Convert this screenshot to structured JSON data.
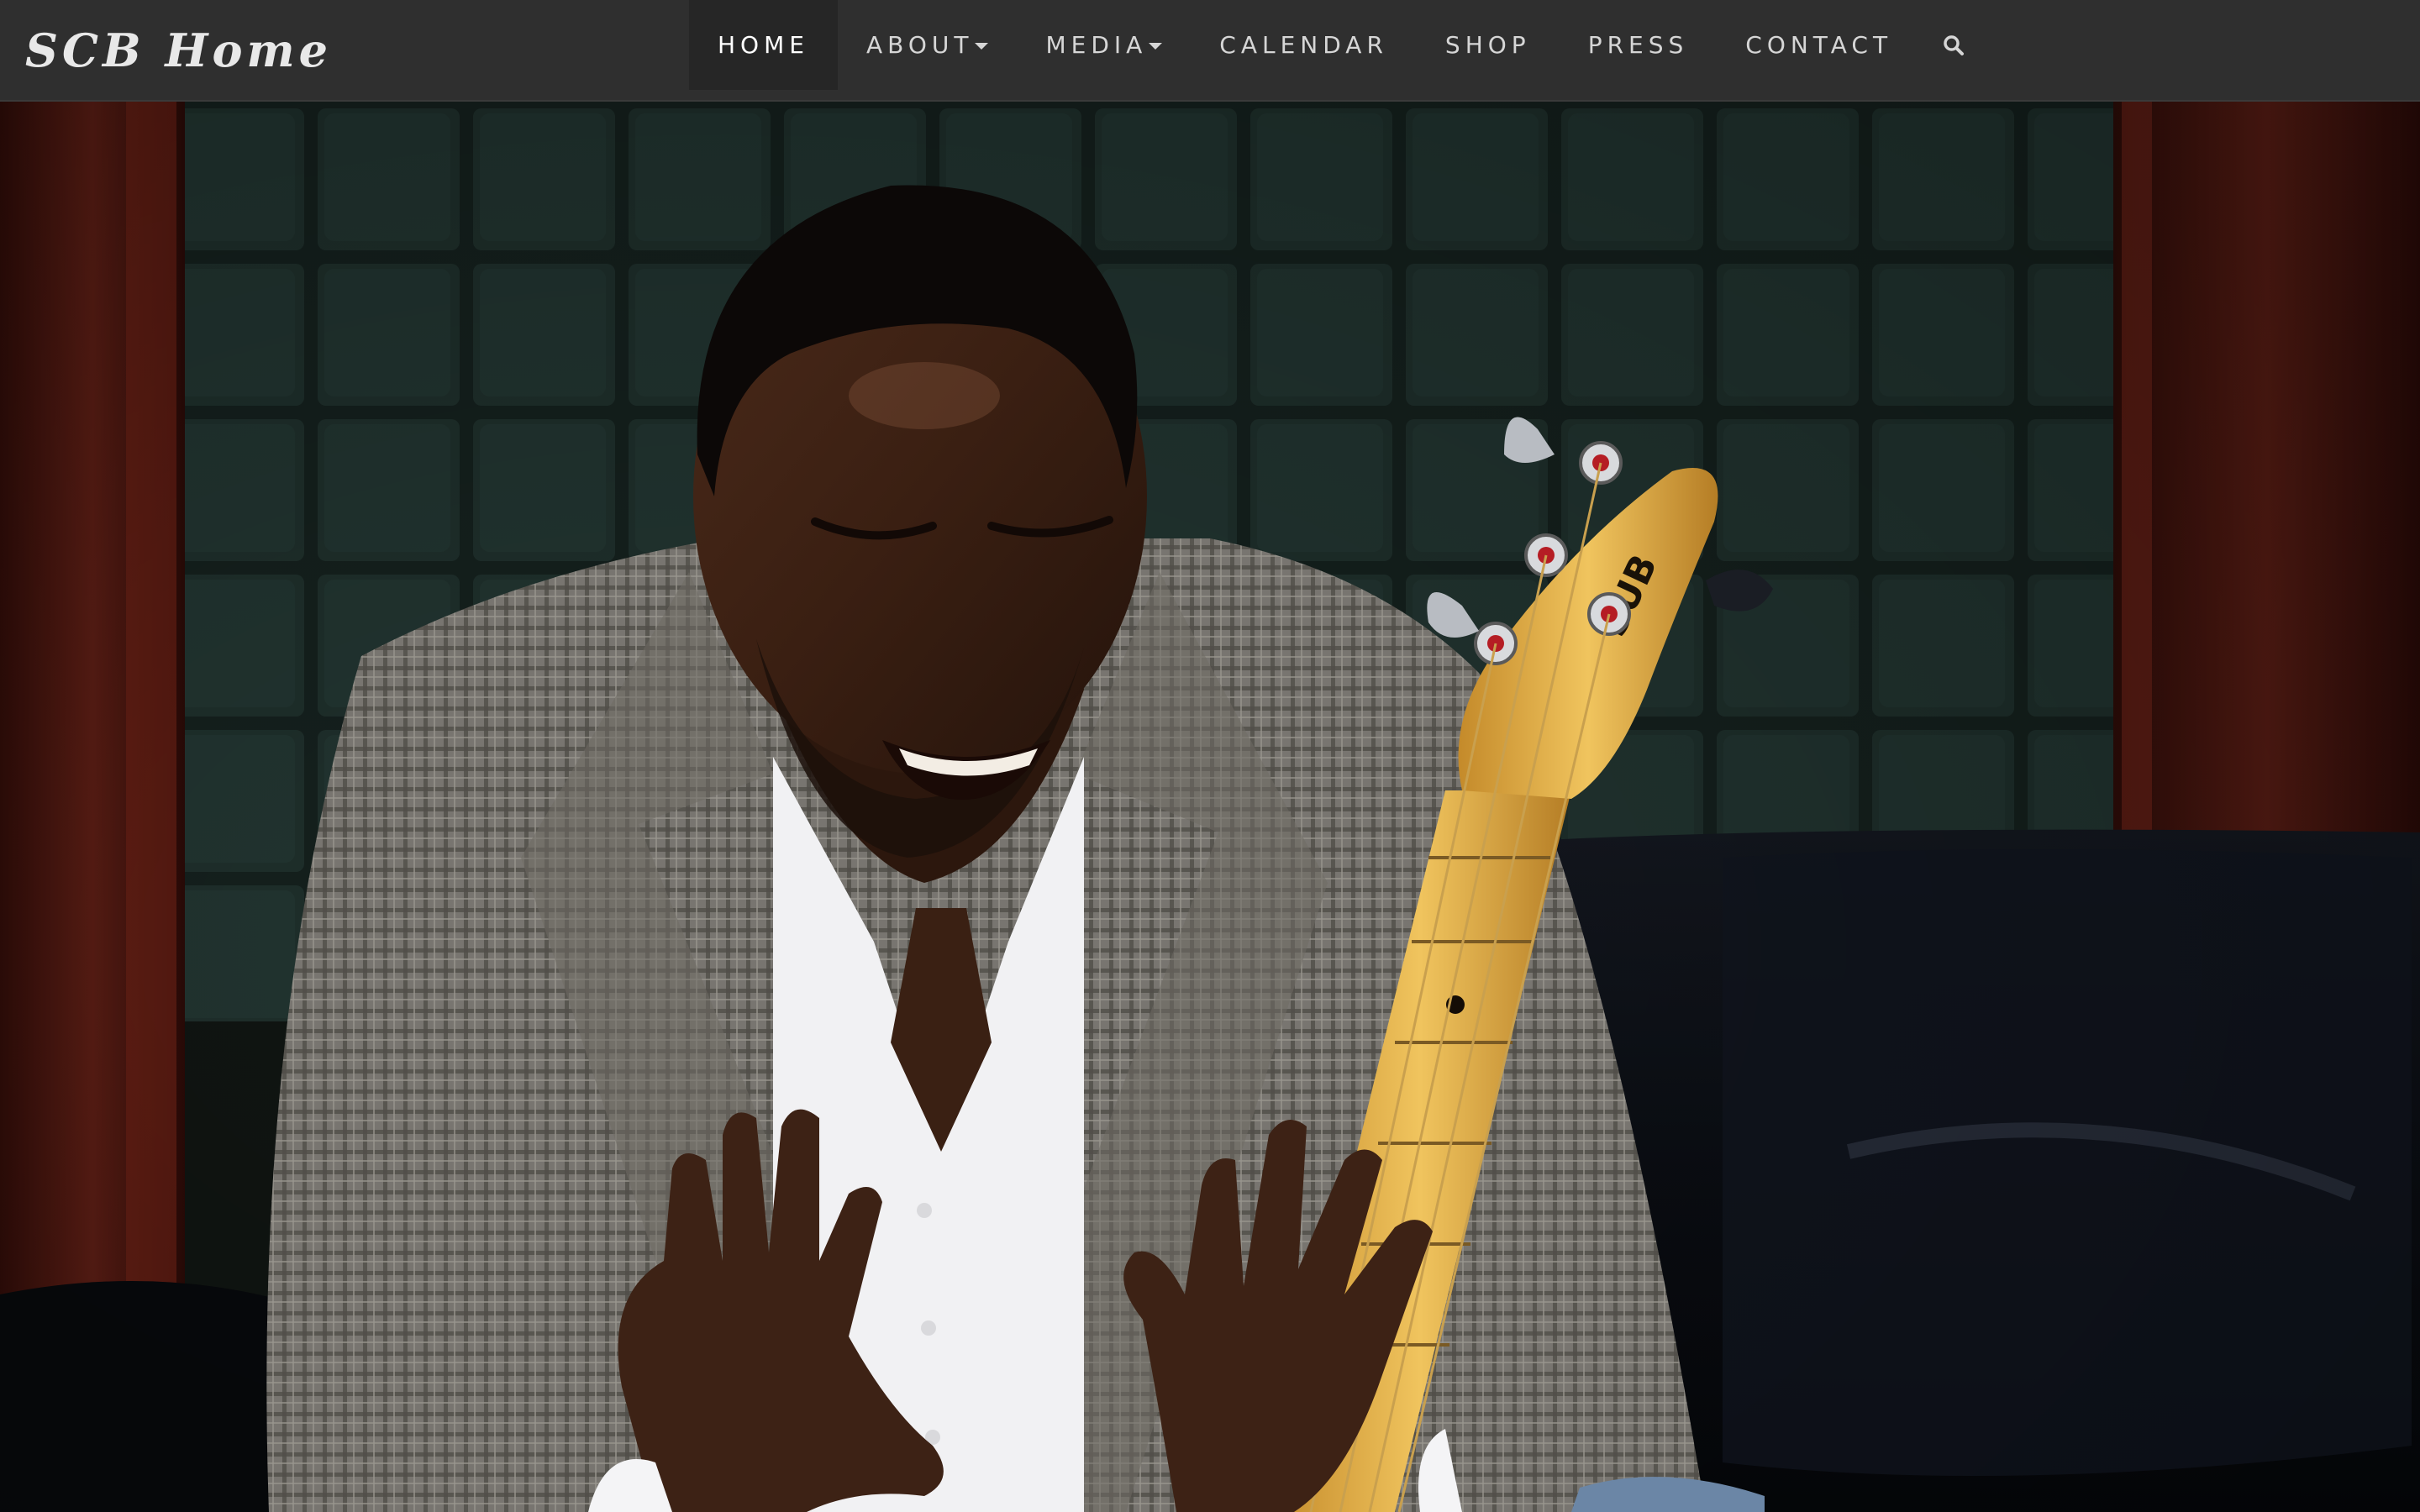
{
  "site": {
    "brand": "SCB Home"
  },
  "nav": {
    "items": [
      {
        "label": "HOME",
        "active": true,
        "dropdown": false
      },
      {
        "label": "ABOUT",
        "active": false,
        "dropdown": true
      },
      {
        "label": "MEDIA",
        "active": false,
        "dropdown": true
      },
      {
        "label": "CALENDAR",
        "active": false,
        "dropdown": false
      },
      {
        "label": "SHOP",
        "active": false,
        "dropdown": false
      },
      {
        "label": "PRESS",
        "active": false,
        "dropdown": false
      },
      {
        "label": "CONTACT",
        "active": false,
        "dropdown": false
      }
    ],
    "search_icon": "search-icon"
  },
  "hero": {
    "image": "smiling-man-with-bass-guitar"
  },
  "colors": {
    "navbar_bg": "#2f2f2f",
    "nav_active_bg": "#262626",
    "nav_text": "#d6d6d6",
    "tile_wall": "#1f302c",
    "wood_frame": "#4a1610",
    "sofa": "#0e1117",
    "jacket": "#8d8a84",
    "guitar_maple": "#e2b24e"
  }
}
